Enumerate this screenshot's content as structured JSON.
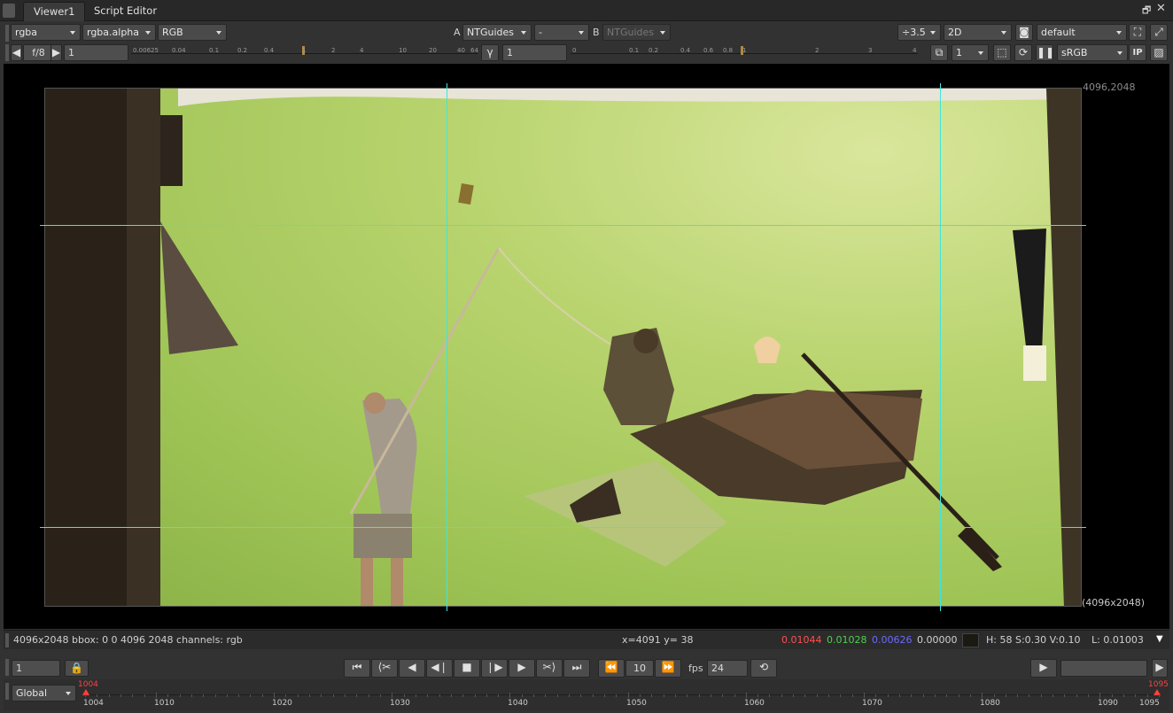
{
  "tabs": [
    "Viewer1",
    "Script Editor"
  ],
  "row1": {
    "layer": "rgba",
    "alpha": "rgba.alpha",
    "display": "RGB",
    "a_label": "A",
    "a_input": "NTGuides",
    "dash": "-",
    "b_label": "B",
    "b_input": "NTGuides",
    "zoom": "÷3.5",
    "view_mode": "2D",
    "lut": "default"
  },
  "row2": {
    "fstop": "f/8",
    "gain": "1",
    "gain_ticks": [
      "0.00625",
      "0.04",
      "0.1",
      "0.2",
      "0.4",
      "1",
      "2",
      "4",
      "10",
      "20",
      "40",
      "64"
    ],
    "gamma_symbol": "γ",
    "gamma": "1",
    "gamma_ticks": [
      "0",
      "0.1",
      "0.2",
      "0.4",
      "0.6",
      "0.8",
      "1",
      "2",
      "3",
      "4"
    ],
    "downscale": "1",
    "colorspace": "sRGB"
  },
  "viewer": {
    "corner_tr": "4096,2048",
    "corner_br": "(4096x2048)"
  },
  "info": {
    "format": "4096x2048 bbox: 0 0 4096 2048 channels: rgb",
    "coords": "x=4091 y=  38",
    "r": "0.01044",
    "g": "0.01028",
    "b": "0.00626",
    "a": "0.00000",
    "hsv": "H: 58 S:0.30 V:0.10",
    "lum": "L: 0.01003"
  },
  "playback": {
    "frame": "1",
    "step": "10",
    "fps_label": "fps",
    "fps": "24"
  },
  "timeline": {
    "mode": "Global",
    "in_mark": "1004",
    "out_mark": "1095",
    "ticks": [
      "1004",
      "1010",
      "1020",
      "1030",
      "1040",
      "1050",
      "1060",
      "1070",
      "1080",
      "1090",
      "1095"
    ]
  },
  "colors": {
    "red": "#ff4f4f",
    "green": "#4ecf4e",
    "blue": "#5a5aff",
    "guides": "#3ee6de"
  }
}
